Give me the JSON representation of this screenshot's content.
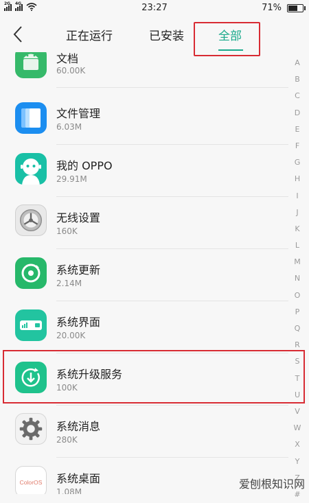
{
  "status_bar": {
    "signal1_tag": "2G",
    "signal2_tag": "4G",
    "time": "23:27",
    "battery_percent": "71%",
    "battery_level": 0.71
  },
  "header": {
    "tabs": [
      "正在运行",
      "已安装",
      "全部"
    ],
    "active_tab": 2,
    "accent_color": "#19a98b",
    "highlight_color": "#d82b33"
  },
  "apps": [
    {
      "name": "文档",
      "size": "60.00K",
      "icon": "android-robot-icon"
    },
    {
      "name": "文件管理",
      "size": "6.03M",
      "icon": "file-manager-icon"
    },
    {
      "name": "我的 OPPO",
      "size": "29.91M",
      "icon": "my-oppo-icon"
    },
    {
      "name": "无线设置",
      "size": "160K",
      "icon": "wireless-settings-icon"
    },
    {
      "name": "系统更新",
      "size": "2.14M",
      "icon": "system-update-icon"
    },
    {
      "name": "系统界面",
      "size": "20.00K",
      "icon": "system-ui-icon"
    },
    {
      "name": "系统升级服务",
      "size": "100K",
      "icon": "system-upgrade-service-icon"
    },
    {
      "name": "系统消息",
      "size": "280K",
      "icon": "system-message-gear-icon"
    },
    {
      "name": "系统桌面",
      "size": "1.08M",
      "icon": "coloros-desktop-icon"
    }
  ],
  "coloros_label": "ColorOS",
  "index_letters": [
    "A",
    "B",
    "C",
    "D",
    "E",
    "F",
    "G",
    "H",
    "I",
    "J",
    "K",
    "L",
    "M",
    "N",
    "O",
    "P",
    "Q",
    "R",
    "S",
    "T",
    "U",
    "V",
    "W",
    "X",
    "Y",
    "Z",
    "#"
  ],
  "watermark": "爱刨根知识网"
}
